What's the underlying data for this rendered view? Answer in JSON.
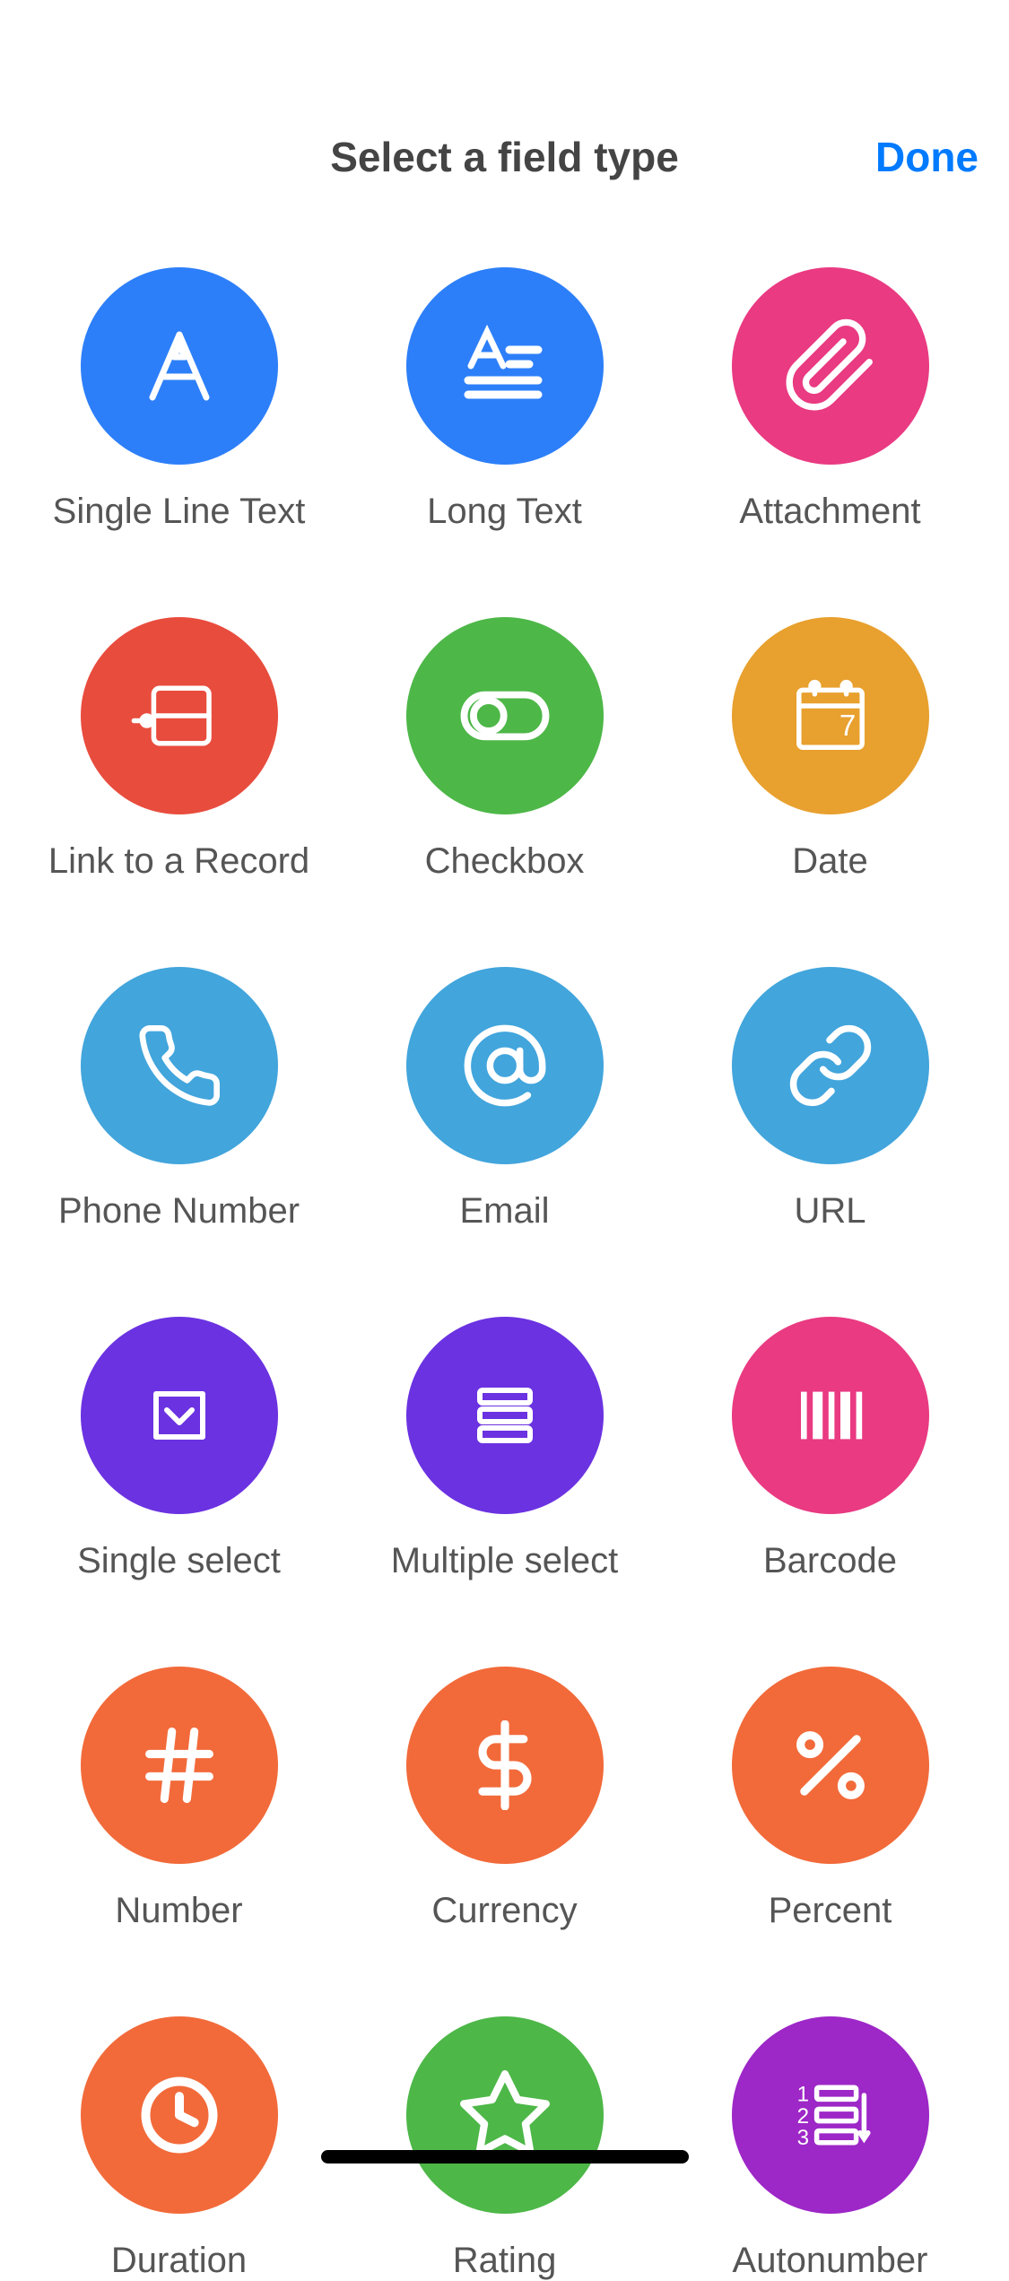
{
  "header": {
    "title": "Select a field type",
    "done": "Done"
  },
  "options": {
    "singleLineText": {
      "label": "Single Line Text",
      "icon": "letter-a-icon",
      "color": "#2d7ff9"
    },
    "longText": {
      "label": "Long Text",
      "icon": "long-text-icon",
      "color": "#2d7ff9"
    },
    "attachment": {
      "label": "Attachment",
      "icon": "paperclip-icon",
      "color": "#e93a82"
    },
    "linkToRecord": {
      "label": "Link to a Record",
      "icon": "link-record-icon",
      "color": "#e84c3d"
    },
    "checkbox": {
      "label": "Checkbox",
      "icon": "toggle-icon",
      "color": "#4db748"
    },
    "date": {
      "label": "Date",
      "icon": "calendar-icon",
      "color": "#e8a02e"
    },
    "phoneNumber": {
      "label": "Phone Number",
      "icon": "phone-icon",
      "color": "#42a5dc"
    },
    "email": {
      "label": "Email",
      "icon": "at-icon",
      "color": "#42a5dc"
    },
    "url": {
      "label": "URL",
      "icon": "link-icon",
      "color": "#42a5dc"
    },
    "singleSelect": {
      "label": "Single select",
      "icon": "dropdown-icon",
      "color": "#6b32e1"
    },
    "multipleSelect": {
      "label": "Multiple select",
      "icon": "list-icon",
      "color": "#6b32e1"
    },
    "barcode": {
      "label": "Barcode",
      "icon": "barcode-icon",
      "color": "#e93a82"
    },
    "number": {
      "label": "Number",
      "icon": "hash-icon",
      "color": "#f26a3a"
    },
    "currency": {
      "label": "Currency",
      "icon": "dollar-icon",
      "color": "#f26a3a"
    },
    "percent": {
      "label": "Percent",
      "icon": "percent-icon",
      "color": "#f26a3a"
    },
    "duration": {
      "label": "Duration",
      "icon": "clock-icon",
      "color": "#f26a3a"
    },
    "rating": {
      "label": "Rating",
      "icon": "star-icon",
      "color": "#4db748"
    },
    "autonumber": {
      "label": "Autonumber",
      "icon": "numbered-list-icon",
      "color": "#9d27c7"
    }
  }
}
